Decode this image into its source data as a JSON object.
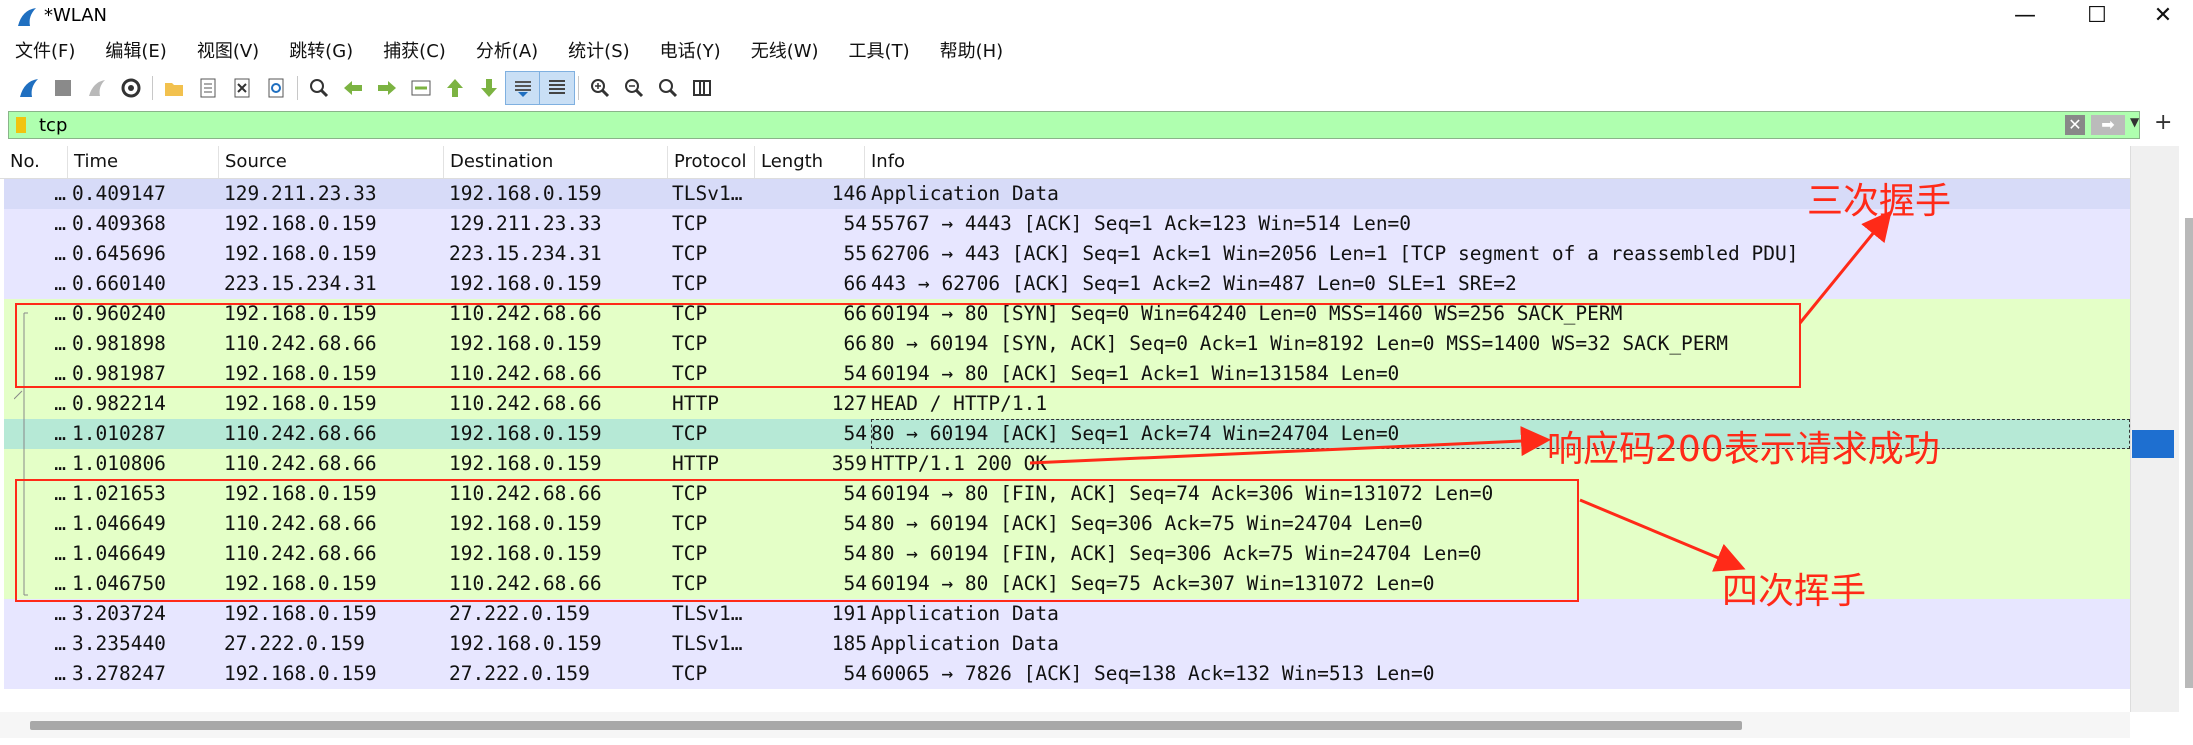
{
  "window": {
    "title": "*WLAN",
    "minimize": "—",
    "maximize": "☐",
    "close": "✕"
  },
  "menu": [
    "文件(F)",
    "编辑(E)",
    "视图(V)",
    "跳转(G)",
    "捕获(C)",
    "分析(A)",
    "统计(S)",
    "电话(Y)",
    "无线(W)",
    "工具(T)",
    "帮助(H)"
  ],
  "toolbar_icons": [
    "shark-fin-start-icon",
    "stop-icon",
    "restart-icon",
    "options-gear-icon",
    "|",
    "open-folder-icon",
    "file-icon",
    "close-file-icon",
    "reload-icon",
    "|",
    "find-icon",
    "back-icon",
    "forward-icon",
    "goto-packet-icon",
    "first-packet-icon",
    "last-packet-icon",
    "autoscroll-icon",
    "colorize-icon",
    "|",
    "zoom-in-icon",
    "zoom-out-icon",
    "zoom-normal-icon",
    "resize-columns-icon"
  ],
  "colors": {
    "filter_bg": "#afffaf",
    "row_tls": "#e7e6ff",
    "row_tcp": "#e7e6ff",
    "row_http": "#e4ffc7",
    "row_selected": "#b6e9d6",
    "row_first": "#d7dbf8",
    "annotation": "#ff2a18"
  },
  "filter": {
    "value": "tcp"
  },
  "columns": [
    "No.",
    "Time",
    "Source",
    "Destination",
    "Protocol",
    "Length",
    "Info"
  ],
  "packets": [
    {
      "no": "…",
      "time": "0.409147",
      "source": "129.211.23.33",
      "destination": "192.168.0.159",
      "protocol": "TLSv1…",
      "length": "146",
      "info": "Application Data",
      "color": "#d7dbf8"
    },
    {
      "no": "…",
      "time": "0.409368",
      "source": "192.168.0.159",
      "destination": "129.211.23.33",
      "protocol": "TCP",
      "length": "54",
      "info": "55767 → 4443 [ACK] Seq=1 Ack=123 Win=514 Len=0",
      "color": "#e7e6ff"
    },
    {
      "no": "…",
      "time": "0.645696",
      "source": "192.168.0.159",
      "destination": "223.15.234.31",
      "protocol": "TCP",
      "length": "55",
      "info": "62706 → 443 [ACK] Seq=1 Ack=1 Win=2056 Len=1 [TCP segment of a reassembled PDU]",
      "color": "#e7e6ff"
    },
    {
      "no": "…",
      "time": "0.660140",
      "source": "223.15.234.31",
      "destination": "192.168.0.159",
      "protocol": "TCP",
      "length": "66",
      "info": "443 → 62706 [ACK] Seq=1 Ack=2 Win=487 Len=0 SLE=1 SRE=2",
      "color": "#e7e6ff"
    },
    {
      "no": "…",
      "time": "0.960240",
      "source": "192.168.0.159",
      "destination": "110.242.68.66",
      "protocol": "TCP",
      "length": "66",
      "info": "60194 → 80 [SYN] Seq=0 Win=64240 Len=0 MSS=1460 WS=256 SACK_PERM",
      "color": "#e4ffc7"
    },
    {
      "no": "…",
      "time": "0.981898",
      "source": "110.242.68.66",
      "destination": "192.168.0.159",
      "protocol": "TCP",
      "length": "66",
      "info": "80 → 60194 [SYN, ACK] Seq=0 Ack=1 Win=8192 Len=0 MSS=1400 WS=32 SACK_PERM",
      "color": "#e4ffc7"
    },
    {
      "no": "…",
      "time": "0.981987",
      "source": "192.168.0.159",
      "destination": "110.242.68.66",
      "protocol": "TCP",
      "length": "54",
      "info": "60194 → 80 [ACK] Seq=1 Ack=1 Win=131584 Len=0",
      "color": "#e4ffc7"
    },
    {
      "no": "…",
      "time": "0.982214",
      "source": "192.168.0.159",
      "destination": "110.242.68.66",
      "protocol": "HTTP",
      "length": "127",
      "info": "HEAD / HTTP/1.1",
      "color": "#e4ffc7"
    },
    {
      "no": "…",
      "time": "1.010287",
      "source": "110.242.68.66",
      "destination": "192.168.0.159",
      "protocol": "TCP",
      "length": "54",
      "info": "80 → 60194 [ACK] Seq=1 Ack=74 Win=24704 Len=0",
      "color": "#b6e9d6"
    },
    {
      "no": "…",
      "time": "1.010806",
      "source": "110.242.68.66",
      "destination": "192.168.0.159",
      "protocol": "HTTP",
      "length": "359",
      "info": "HTTP/1.1 200 OK",
      "color": "#e4ffc7"
    },
    {
      "no": "…",
      "time": "1.021653",
      "source": "192.168.0.159",
      "destination": "110.242.68.66",
      "protocol": "TCP",
      "length": "54",
      "info": "60194 → 80 [FIN, ACK] Seq=74 Ack=306 Win=131072 Len=0",
      "color": "#e4ffc7"
    },
    {
      "no": "…",
      "time": "1.046649",
      "source": "110.242.68.66",
      "destination": "192.168.0.159",
      "protocol": "TCP",
      "length": "54",
      "info": "80 → 60194 [ACK] Seq=306 Ack=75 Win=24704 Len=0",
      "color": "#e4ffc7"
    },
    {
      "no": "…",
      "time": "1.046649",
      "source": "110.242.68.66",
      "destination": "192.168.0.159",
      "protocol": "TCP",
      "length": "54",
      "info": "80 → 60194 [FIN, ACK] Seq=306 Ack=75 Win=24704 Len=0",
      "color": "#e4ffc7"
    },
    {
      "no": "…",
      "time": "1.046750",
      "source": "192.168.0.159",
      "destination": "110.242.68.66",
      "protocol": "TCP",
      "length": "54",
      "info": "60194 → 80 [ACK] Seq=75 Ack=307 Win=131072 Len=0",
      "color": "#e4ffc7"
    },
    {
      "no": "…",
      "time": "3.203724",
      "source": "192.168.0.159",
      "destination": "27.222.0.159",
      "protocol": "TLSv1…",
      "length": "191",
      "info": "Application Data",
      "color": "#e7e6ff"
    },
    {
      "no": "…",
      "time": "3.235440",
      "source": "27.222.0.159",
      "destination": "192.168.0.159",
      "protocol": "TLSv1…",
      "length": "185",
      "info": "Application Data",
      "color": "#e7e6ff"
    },
    {
      "no": "…",
      "time": "3.278247",
      "source": "192.168.0.159",
      "destination": "27.222.0.159",
      "protocol": "TCP",
      "length": "54",
      "info": "60065 → 7826 [ACK] Seq=138 Ack=132 Win=513 Len=0",
      "color": "#e7e6ff"
    }
  ],
  "annotations": {
    "handshake": "三次握手",
    "response": "响应码200表示请求成功",
    "teardown": "四次挥手"
  }
}
